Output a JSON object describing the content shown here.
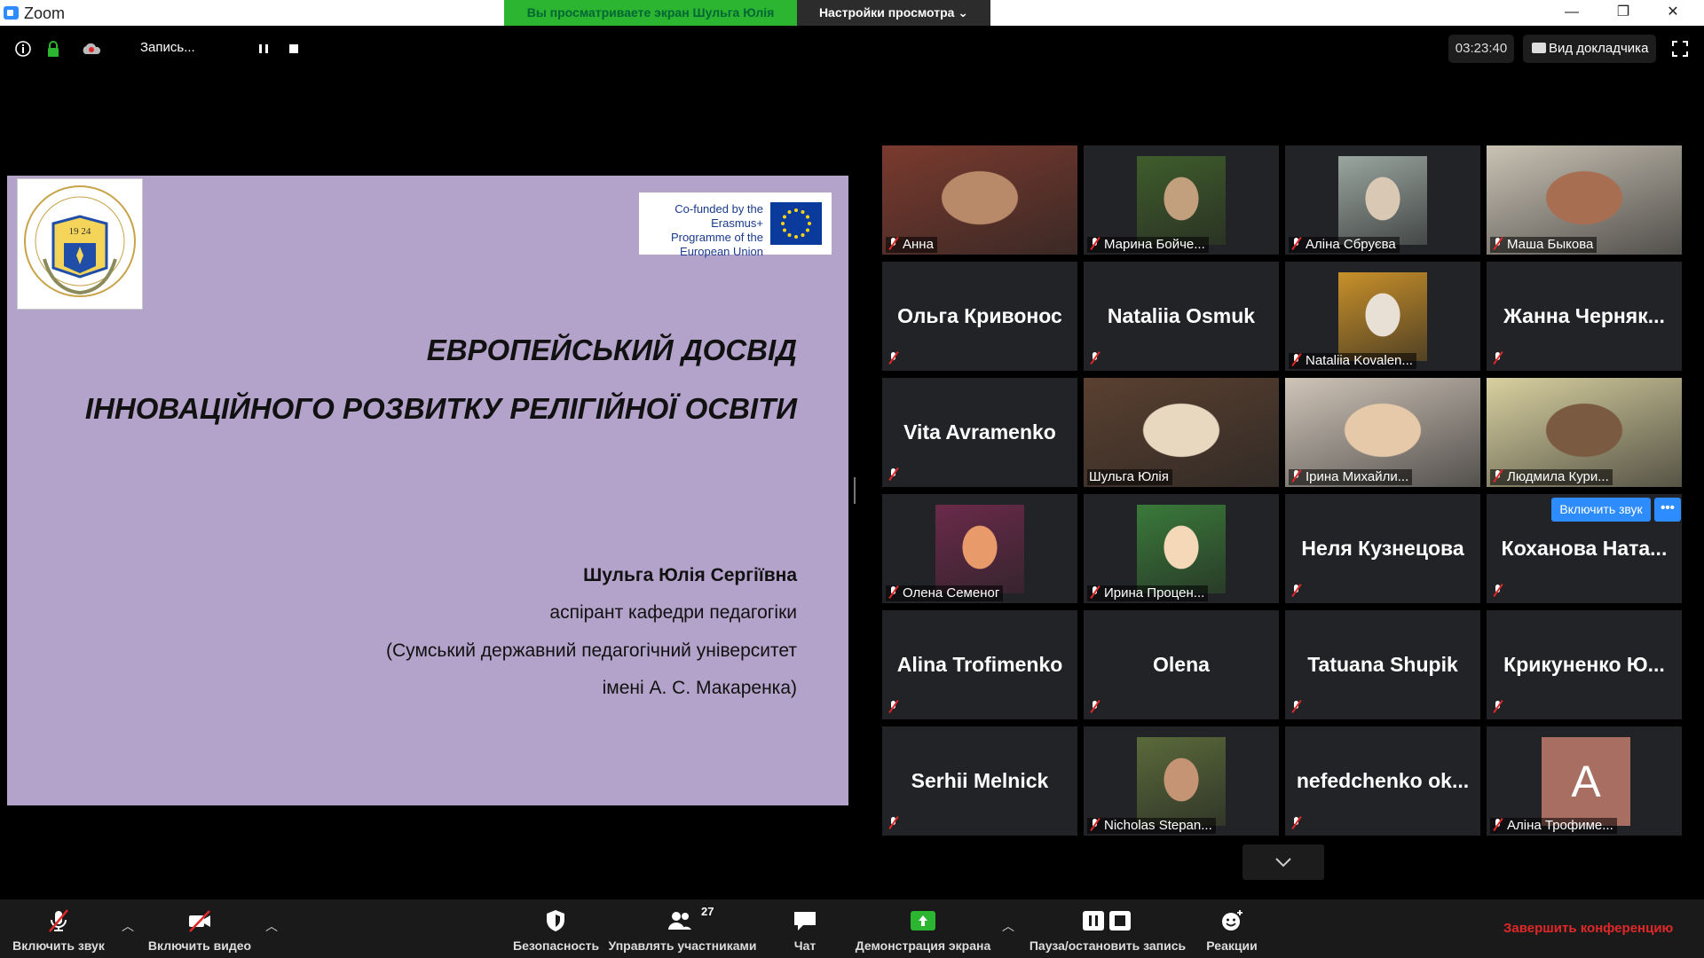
{
  "window": {
    "app_title": "Zoom",
    "share_banner": "Вы просматриваете экран Шульга Юлія",
    "view_options": "Настройки просмотра ⌄",
    "minimize": "—",
    "restore": "❐",
    "close": "✕"
  },
  "topbar": {
    "recording_label": "Запись...",
    "timer": "03:23:40",
    "speaker_view": "Вид докладчика"
  },
  "slide": {
    "title_line1": "ЕВРОПЕЙСЬКИЙ ДОСВІД",
    "title_line2": "ІННОВАЦІЙНОГО РОЗВИТКУ РЕЛІГІЙНОЇ ОСВІТИ",
    "author": "Шульга Юлія Сергіївна",
    "role": "аспірант кафедри педагогіки",
    "university_line1": "(Сумський державний педагогічний університет",
    "university_line2": "імені А. С. Макаренка)",
    "erasmus_text": "Co-funded by the Erasmus+ Programme of the European Union",
    "logo_year": "19 24"
  },
  "participants": [
    {
      "name": "Анна",
      "mode": "video"
    },
    {
      "name": "Марина Бойче...",
      "mode": "video"
    },
    {
      "name": "Аліна Сбруєва",
      "mode": "video"
    },
    {
      "name": "Маша Быкова",
      "mode": "video"
    },
    {
      "name": "Ольга Кривонос",
      "mode": "name"
    },
    {
      "name": "Nataliia Osmuk",
      "mode": "name"
    },
    {
      "name": "Nataliia Kovalen...",
      "mode": "video"
    },
    {
      "name": "Жанна Черняк...",
      "mode": "name"
    },
    {
      "name": "Vita Avramenko",
      "mode": "name"
    },
    {
      "name": "Шульга Юлія",
      "mode": "video"
    },
    {
      "name": "Ірина Михайли...",
      "mode": "video"
    },
    {
      "name": "Людмила Кури...",
      "mode": "video"
    },
    {
      "name": "Олена Семеног",
      "mode": "video"
    },
    {
      "name": "Ирина Процен...",
      "mode": "video"
    },
    {
      "name": "Неля Кузнецова",
      "mode": "name"
    },
    {
      "name": "Коханова Ната...",
      "mode": "name"
    },
    {
      "name": "Alina Trofimenko",
      "mode": "name"
    },
    {
      "name": "Olena",
      "mode": "name"
    },
    {
      "name": "Tatuana Shupik",
      "mode": "name"
    },
    {
      "name": "Крикуненко Ю...",
      "mode": "name"
    },
    {
      "name": "Serhii Melnick",
      "mode": "name"
    },
    {
      "name": "Nicholas Stepan...",
      "mode": "video"
    },
    {
      "name": "nefedchenko ok...",
      "mode": "name"
    },
    {
      "name": "Аліна Трофиме...",
      "mode": "avatar"
    }
  ],
  "avatar_letter": "A",
  "unmute_request": "Включить звук",
  "more": "•••",
  "toolbar": {
    "audio": "Включить звук",
    "video": "Включить видео",
    "security": "Безопасность",
    "participants": "Управлять участниками",
    "participants_count": "27",
    "chat": "Чат",
    "share": "Демонстрация экрана",
    "record": "Пауза/остановить запись",
    "reactions": "Реакции",
    "end": "Завершить конференцию"
  }
}
